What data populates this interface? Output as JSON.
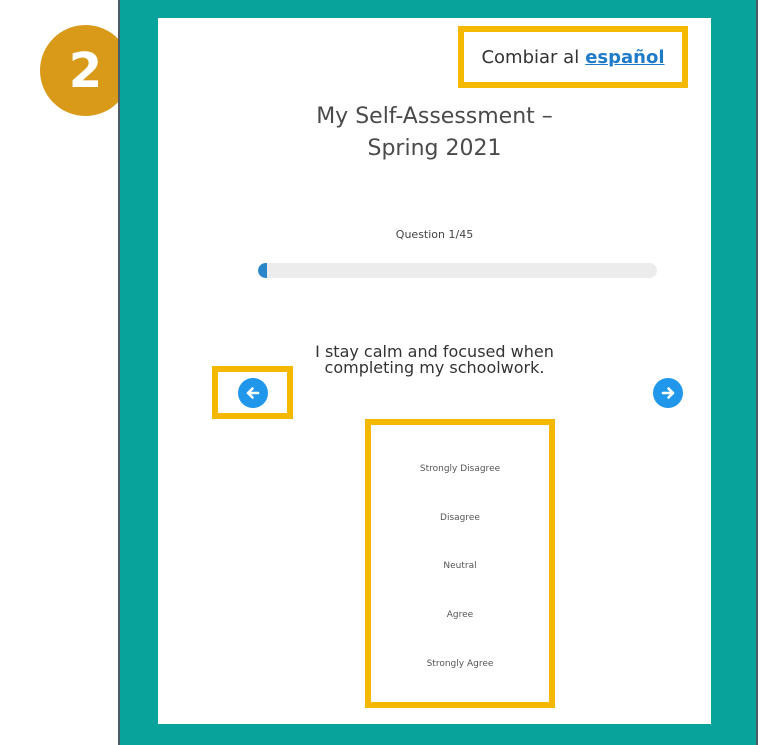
{
  "step": {
    "number": "2"
  },
  "language": {
    "prefix": "Combiar al",
    "link": "español"
  },
  "assessment": {
    "title_line1": "My Self-Assessment –",
    "title_line2": "Spring 2021"
  },
  "question": {
    "counter": "Question 1/45",
    "progress_fraction": 0.022,
    "text_line1": "I stay calm and focused when",
    "text_line2": "completing my schoolwork."
  },
  "navigation": {
    "prev_icon": "arrow-left-icon",
    "next_icon": "arrow-right-icon"
  },
  "options": [
    "Strongly Disagree",
    "Disagree",
    "Neutral",
    "Agree",
    "Strongly Agree"
  ],
  "colors": {
    "frame": "#08a39a",
    "highlight": "#f5b800",
    "badge": "#d99a1a",
    "accent": "#2197eb",
    "link": "#1f7ac8"
  }
}
